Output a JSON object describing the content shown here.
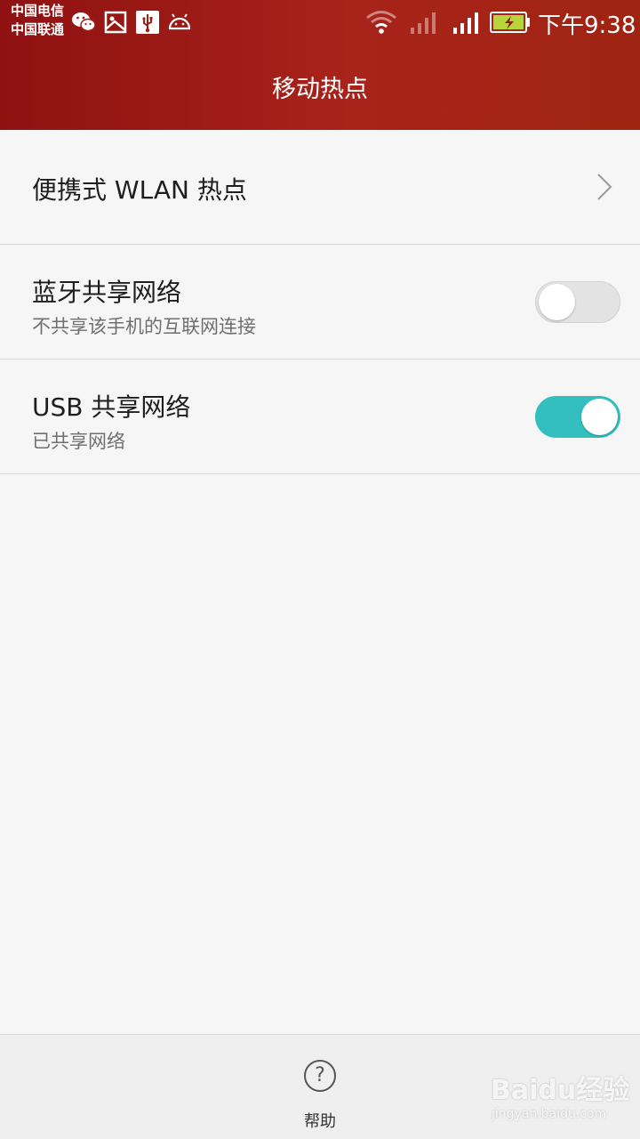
{
  "status_bar": {
    "carrier_1": "中国电信",
    "carrier_2": "中国联通",
    "time": "下午9:38",
    "icons": [
      "wechat-icon",
      "image-icon",
      "usb-icon",
      "android-icon",
      "wifi-icon",
      "signal-icon",
      "signal-icon",
      "battery-charging-icon"
    ]
  },
  "header": {
    "title": "移动热点"
  },
  "settings": [
    {
      "title": "便携式 WLAN 热点",
      "control": "chevron"
    },
    {
      "title": "蓝牙共享网络",
      "subtitle": "不共享该手机的互联网连接",
      "toggle": false
    },
    {
      "title": "USB 共享网络",
      "subtitle": "已共享网络",
      "toggle": true
    }
  ],
  "bottom_bar": {
    "help_label": "帮助",
    "help_icon": "?"
  },
  "watermark": {
    "text": "Baidu经验",
    "sub": "jingyan.baidu.com"
  },
  "colors": {
    "header_bg": "#a01c14",
    "toggle_on": "#33bfbf",
    "toggle_off": "#e3e3e3"
  }
}
